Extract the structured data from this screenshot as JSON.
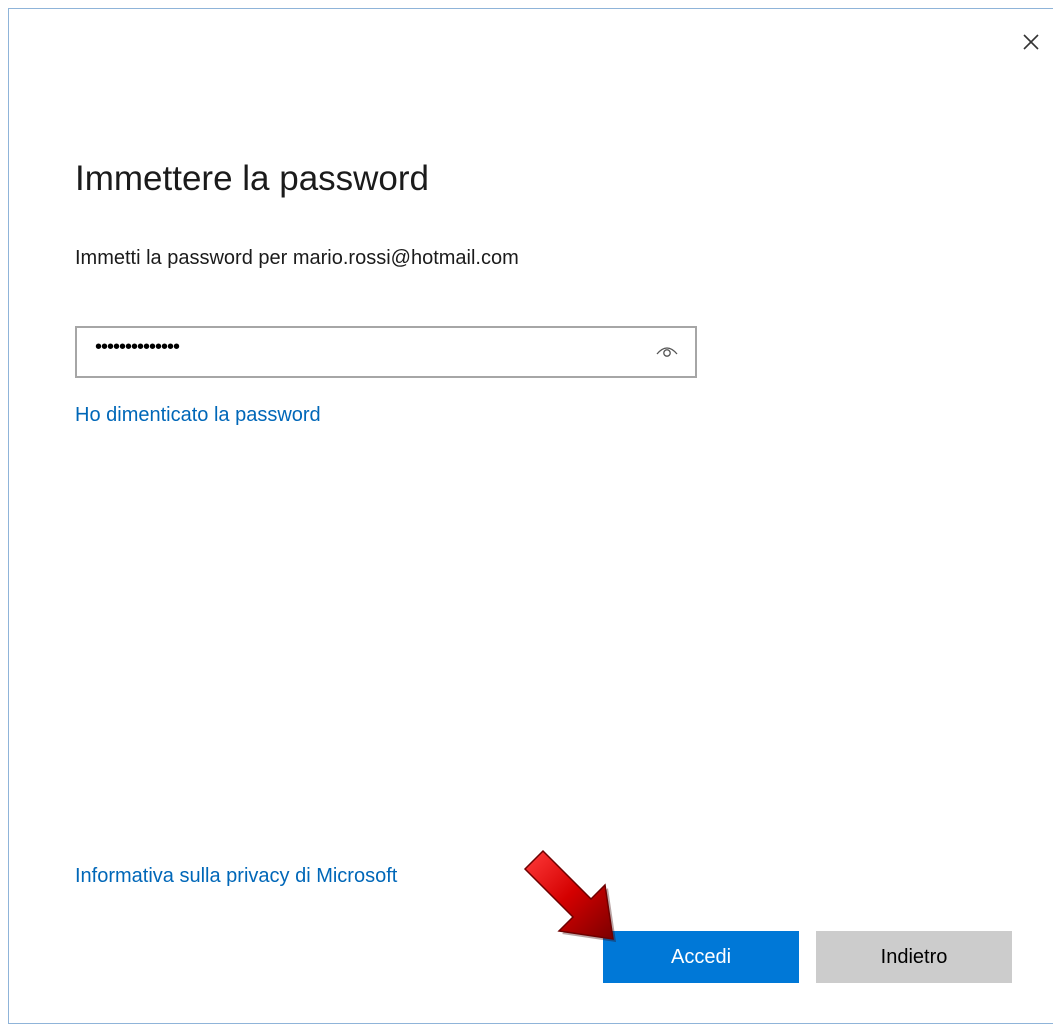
{
  "dialog": {
    "title": "Immettere la password",
    "subtitle": "Immetti la password per mario.rossi@hotmail.com"
  },
  "password_field": {
    "value": "••••••••••••••",
    "reveal_icon": "eye-icon"
  },
  "links": {
    "forgot_password": "Ho dimenticato la password",
    "privacy": "Informativa sulla privacy di Microsoft"
  },
  "buttons": {
    "sign_in": "Accedi",
    "back": "Indietro"
  },
  "icons": {
    "close": "close-icon",
    "annotation": "red-arrow-icon"
  },
  "colors": {
    "primary": "#0078d7",
    "link": "#0067b8",
    "secondary_button": "#cccccc",
    "annotation_arrow": "#c00000"
  }
}
